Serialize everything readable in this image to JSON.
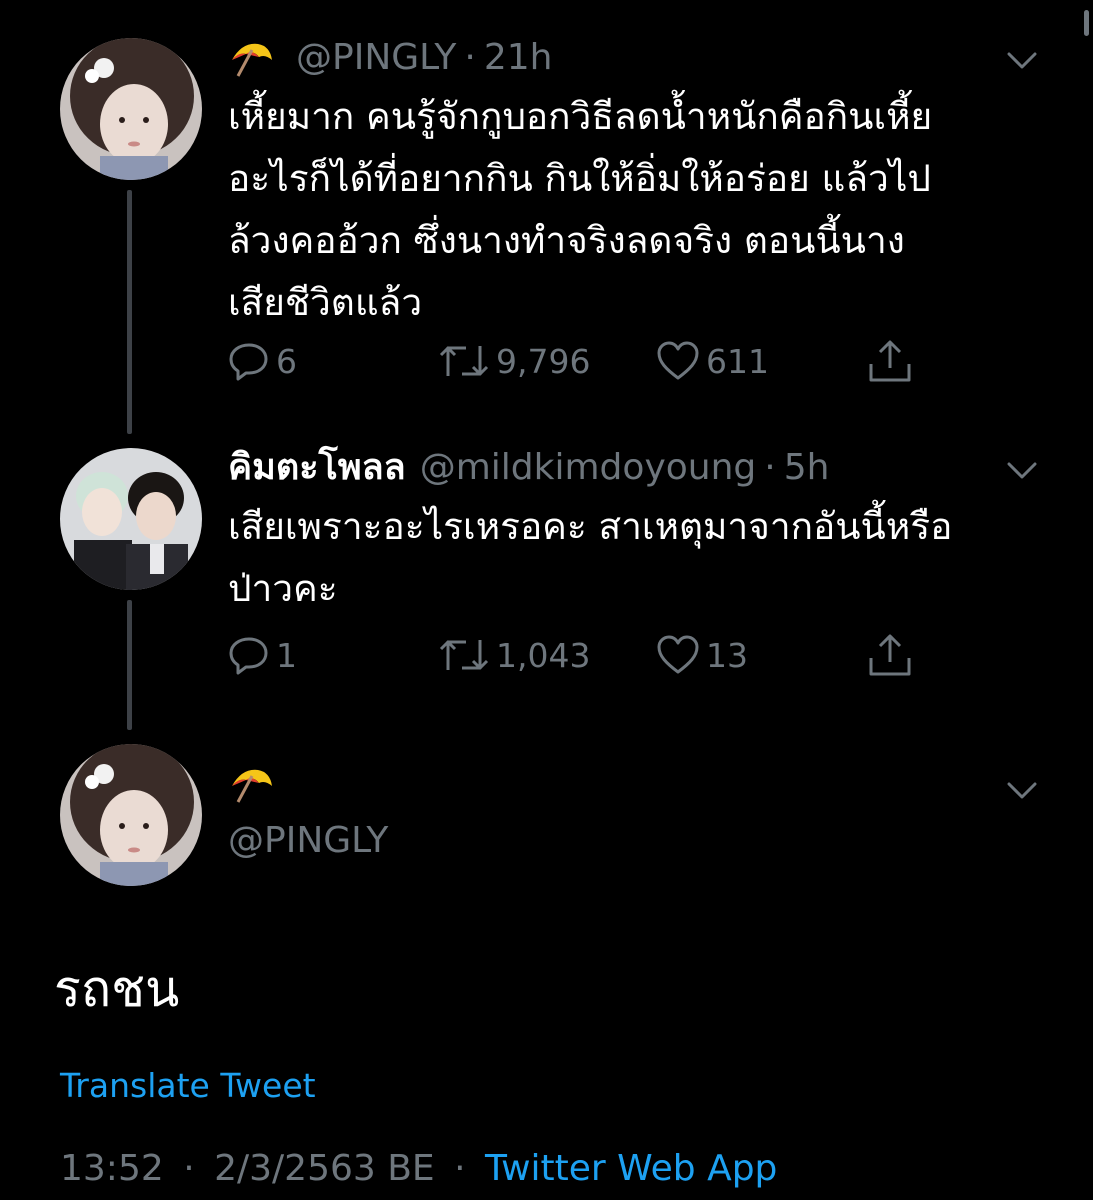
{
  "tweets": [
    {
      "display_emoji": "umbrella-emoji",
      "handle": "@PINGLY",
      "separator": "·",
      "time": "21h",
      "lines": [
        "เหี้ยมาก คนรู้จักกูบอกวิธีลดน้ำหนักคือกินเหี้ย",
        "อะไรก็ได้ที่อยากกิน กินให้อิ่มให้อร่อย แล้วไป",
        "ล้วงคออ้วก ซึ่งนางทำจริงลดจริง ตอนนี้นาง",
        "เสียชีวิตแล้ว"
      ],
      "replies": "6",
      "retweets": "9,796",
      "likes": "611"
    },
    {
      "display_name": "คิมตะโพลล",
      "handle": "@mildkimdoyoung",
      "separator": "·",
      "time": "5h",
      "lines": [
        "เสียเพราะอะไรเหรอคะ สาเหตุมาจากอันนี้หรือ",
        "ป่าวคะ"
      ],
      "replies": "1",
      "retweets": "1,043",
      "likes": "13"
    }
  ],
  "main_tweet": {
    "display_emoji": "umbrella-emoji",
    "handle": "@PINGLY",
    "text": "รถชน",
    "translate_label": "Translate Tweet",
    "time": "13:52",
    "separator": "·",
    "date": "2/3/2563 BE",
    "source": "Twitter Web App"
  },
  "colors": {
    "background": "#000000",
    "text": "#ffffff",
    "muted": "#6e767d",
    "link": "#1da1f2",
    "thread_line": "#3d4147"
  },
  "icons": {
    "reply": "reply-icon",
    "retweet": "retweet-icon",
    "like": "heart-icon",
    "share": "share-icon",
    "more": "chevron-down-icon"
  }
}
